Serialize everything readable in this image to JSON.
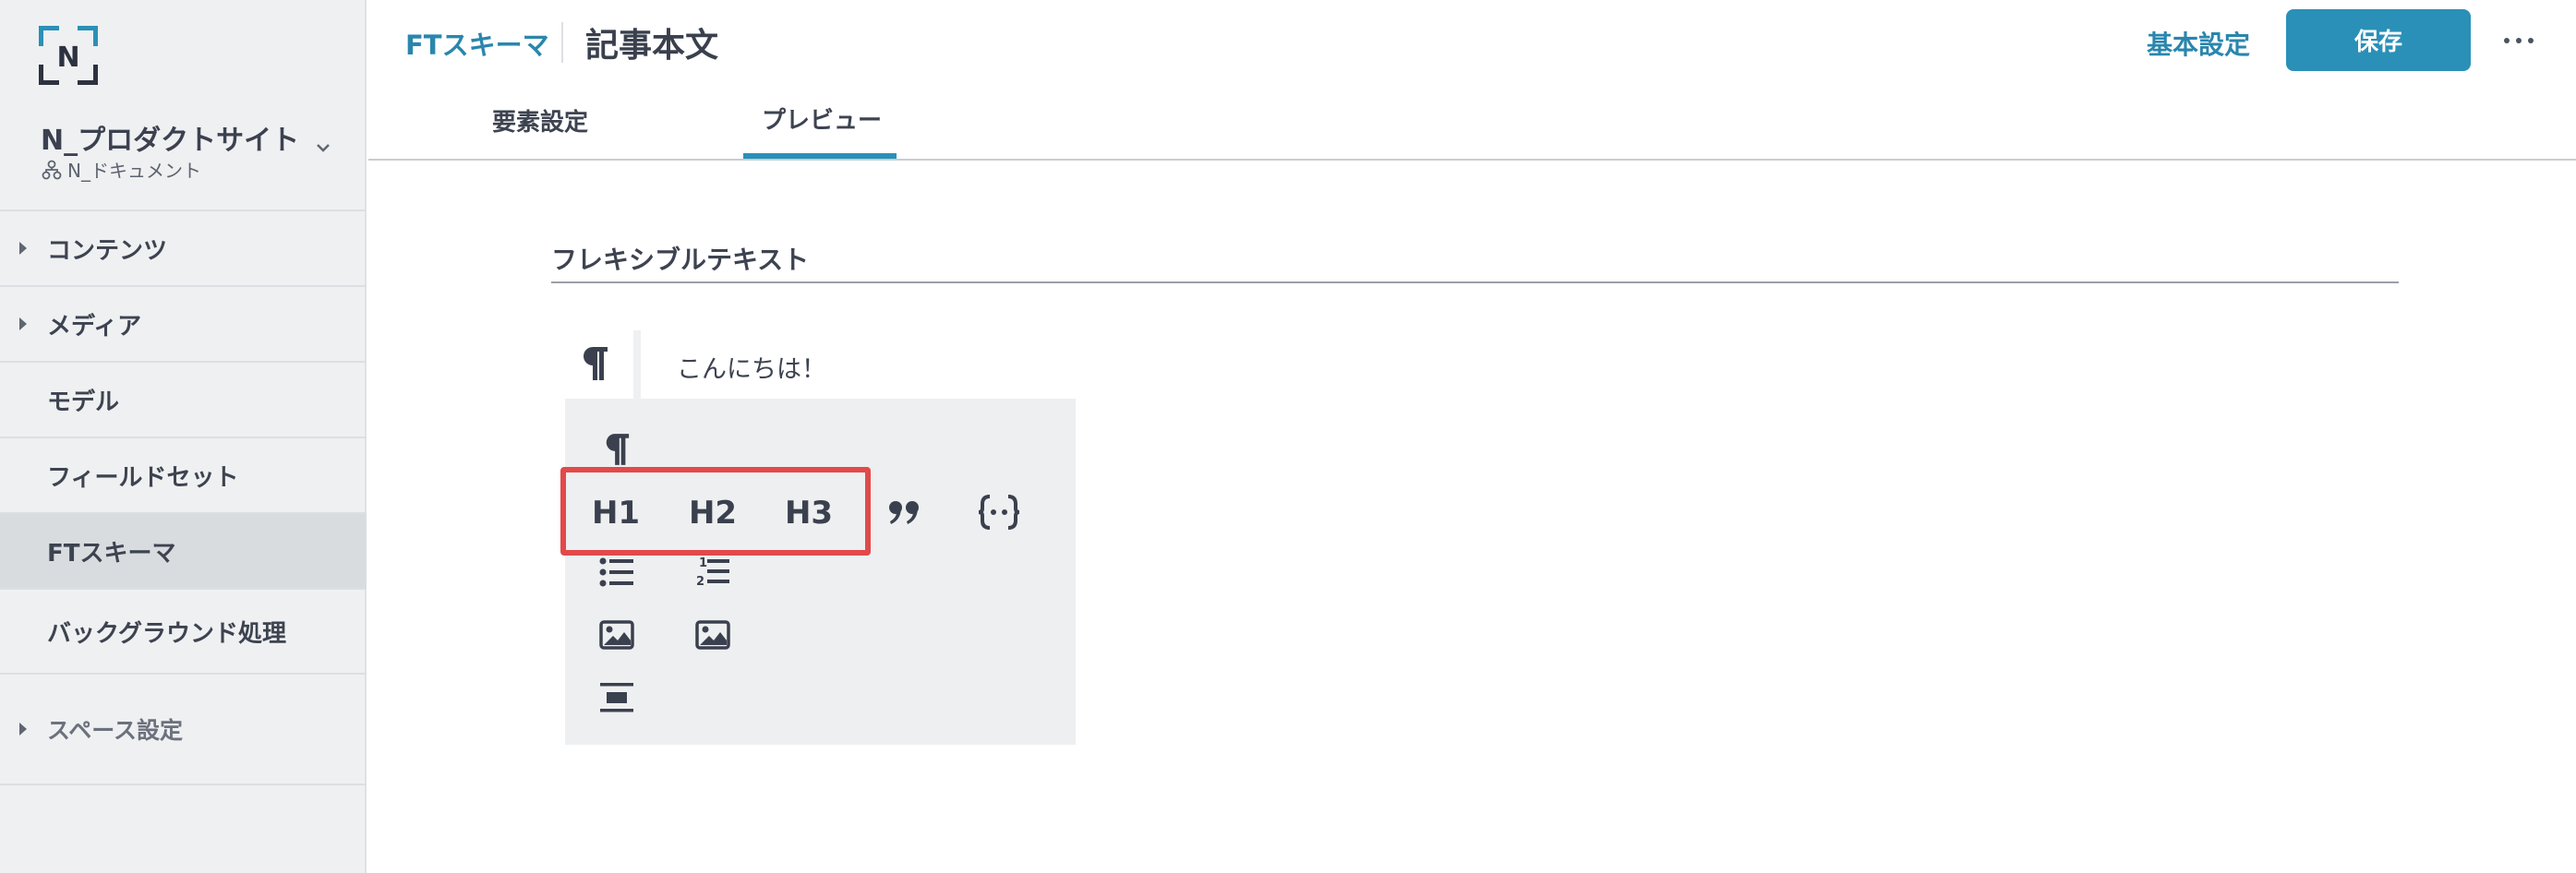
{
  "sidebar": {
    "site_name": "N_プロダクトサイト",
    "site_sub": "N_ドキュメント",
    "items": [
      {
        "label": "コンテンツ"
      },
      {
        "label": "メディア"
      },
      {
        "label": "モデル"
      },
      {
        "label": "フィールドセット"
      },
      {
        "label": "FTスキーマ"
      },
      {
        "label": "バックグラウンド処理"
      },
      {
        "label": "スペース設定"
      }
    ]
  },
  "header": {
    "breadcrumb": "FTスキーマ",
    "title": "記事本文",
    "basic_settings": "基本設定",
    "save_label": "保存"
  },
  "tabs": [
    {
      "label": "要素設定"
    },
    {
      "label": "プレビュー"
    }
  ],
  "main": {
    "section_title": "フレキシブルテキスト",
    "editor_text": "こんにちは！",
    "toolbar": {
      "h1": "H1",
      "h2": "H2",
      "h3": "H3",
      "icons": [
        "paragraph-icon",
        "blockquote-icon",
        "code-block-icon",
        "bullet-list-icon",
        "ordered-list-icon",
        "image-icon",
        "image-icon",
        "horizontal-rule-icon"
      ]
    }
  },
  "colors": {
    "accent": "#2a90b8",
    "link": "#2a86ad",
    "highlight": "#e2494a",
    "sidebar_bg": "#eff0f1"
  }
}
